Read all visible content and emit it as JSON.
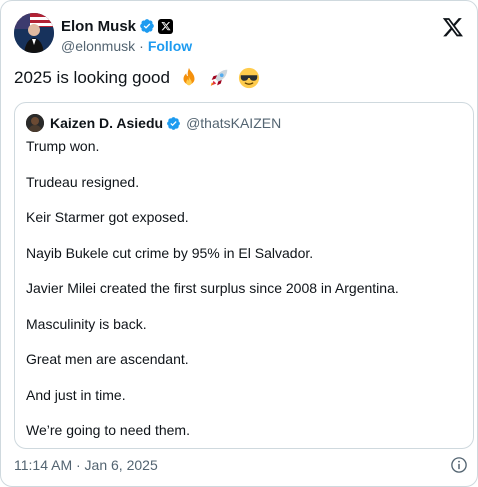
{
  "author": {
    "display_name": "Elon Musk",
    "handle": "@elonmusk",
    "separator": "·",
    "follow_label": "Follow"
  },
  "tweet": {
    "text": "2025 is looking good",
    "emojis": [
      "fire-emoji",
      "rocket-emoji",
      "sunglasses-emoji"
    ]
  },
  "quoted": {
    "display_name": "Kaizen D. Asiedu",
    "handle": "@thatsKAIZEN",
    "lines": [
      "Trump won.",
      "Trudeau resigned.",
      "Keir Starmer got exposed.",
      "Nayib Bukele cut crime by 95% in El Salvador.",
      "Javier Milei created the first surplus since 2008 in Argentina.",
      "Masculinity is back.",
      "Great men are ascendant.",
      "And just in time.",
      "We’re going to need them."
    ]
  },
  "footer": {
    "timestamp": "11:14 AM · Jan 6, 2025"
  },
  "colors": {
    "verified_blue": "#1d9bf0",
    "secondary_text": "#536471",
    "border": "#cfd9de"
  },
  "icons": [
    "verified-badge-icon",
    "x-affiliation-icon",
    "x-logo-icon",
    "info-icon"
  ]
}
